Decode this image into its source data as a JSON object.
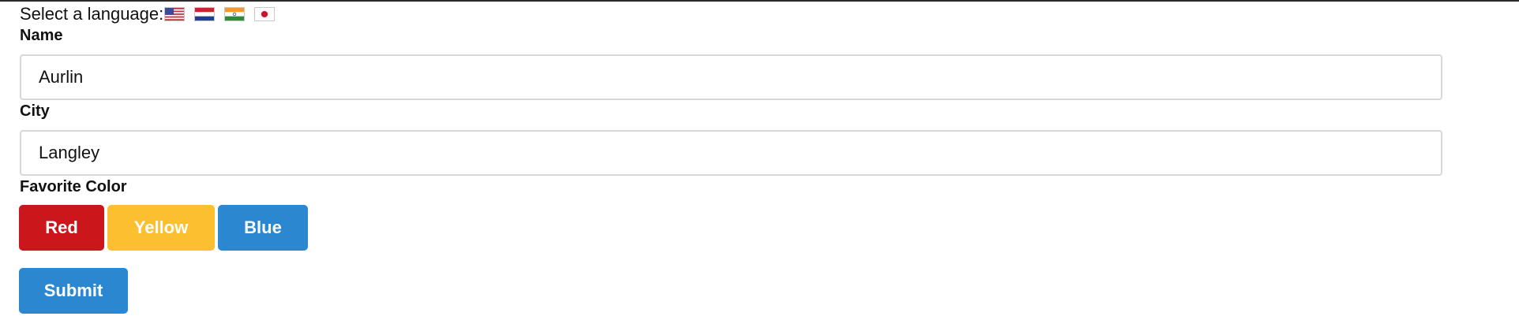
{
  "language": {
    "label": "Select a language:",
    "flags": [
      {
        "icon": "us-flag-icon"
      },
      {
        "icon": "netherlands-flag-icon"
      },
      {
        "icon": "india-flag-icon"
      },
      {
        "icon": "japan-flag-icon"
      }
    ]
  },
  "form": {
    "name_label": "Name",
    "name_value": "Aurlin",
    "city_label": "City",
    "city_value": "Langley",
    "color_label": "Favorite Color",
    "colors": {
      "red": {
        "label": "Red",
        "color": "#cb161b"
      },
      "yellow": {
        "label": "Yellow",
        "color": "#fbbf30"
      },
      "blue": {
        "label": "Blue",
        "color": "#2b88d0"
      }
    },
    "submit_label": "Submit",
    "submit_color": "#2b88d0"
  }
}
